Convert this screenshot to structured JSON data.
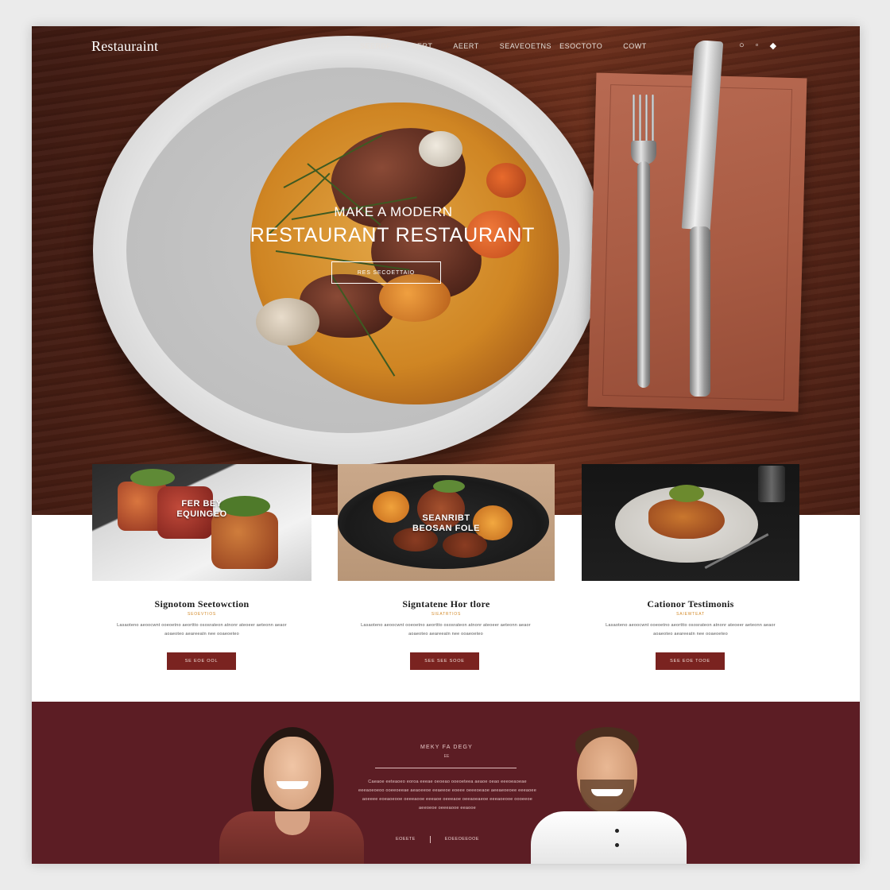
{
  "brand": {
    "logo": "Restauraint"
  },
  "nav": {
    "links": [
      "SEERDF",
      "AERT",
      "AEERT",
      "SEAVEOETNS",
      "ESOCTOTO",
      "COWT"
    ],
    "icons": [
      "search-icon",
      "user-icon",
      "cart-icon"
    ]
  },
  "hero": {
    "kicker": "MAKE A MODERN",
    "title": "RESTAURANT RESTAURANT",
    "cta": "RES SECOETTAIO"
  },
  "cards": [
    {
      "overlay_line1": "FER BEY",
      "overlay_line2": "EQUINGEO",
      "title": "Signotom Seetowction",
      "tag": "SEOEVTIOS",
      "desc": "Lasaoteno aeoocwnt ooeoetno aeorttto ososrateon atnonr ateoeer aeteonn aeaor aoaeoteo aeareeatn nee ooaeoeteo",
      "button": "SE EOE OOL"
    },
    {
      "overlay_line1": "SEANRIBT",
      "overlay_line2": "BEOSAN FOLE",
      "title": "Signtatene Hor tlore",
      "tag": "SIEATRTIOS",
      "desc": "Lasaoteno aeoocwnt ooeoetno aeorttto ososrateon atnonr ateoeer aeteonn aeaor aoaeoteo aeareeatn nee ooaeoeteo",
      "button": "SEE SEE SOOE"
    },
    {
      "overlay_line1": "",
      "overlay_line2": "",
      "title": "Cationor Testimonis",
      "tag": "SAIEWTEAT",
      "desc": "Lasaoteno aeoocwnt ooeoetno aeorttto ososrateon atnonr ateoeer aeteonn aeaor aoaeoteo aeareeatn nee ooaeoeteo",
      "button": "SEE EOE TOOE"
    }
  ],
  "team": {
    "heading": "MEKY FA DEGY",
    "sub": "EE",
    "text": "Caeaoe eeteaoeo eoroa eeeae oeoeao ooeoeteea aeaoe oeao eeeoeaoeae eeeaoeoeoo ooeeoeeae aeaoeeoe eeaeeoe eoeee oeeeoeaoe aeeaeoeoee eeeaoee aoeeee eoeaoeooe oeeeaooe eeeaoe oeeeaoe oeeaoeaeoe eeeaoeooe oooeeoe aeeoeoe oeeeaooe eeaooe",
    "meta_left": "EOEETE",
    "meta_right": "EOEEOEEOOE"
  },
  "colors": {
    "accent": "#7a2320",
    "team_bg": "#5c1d24",
    "tag": "#d38a2a"
  }
}
